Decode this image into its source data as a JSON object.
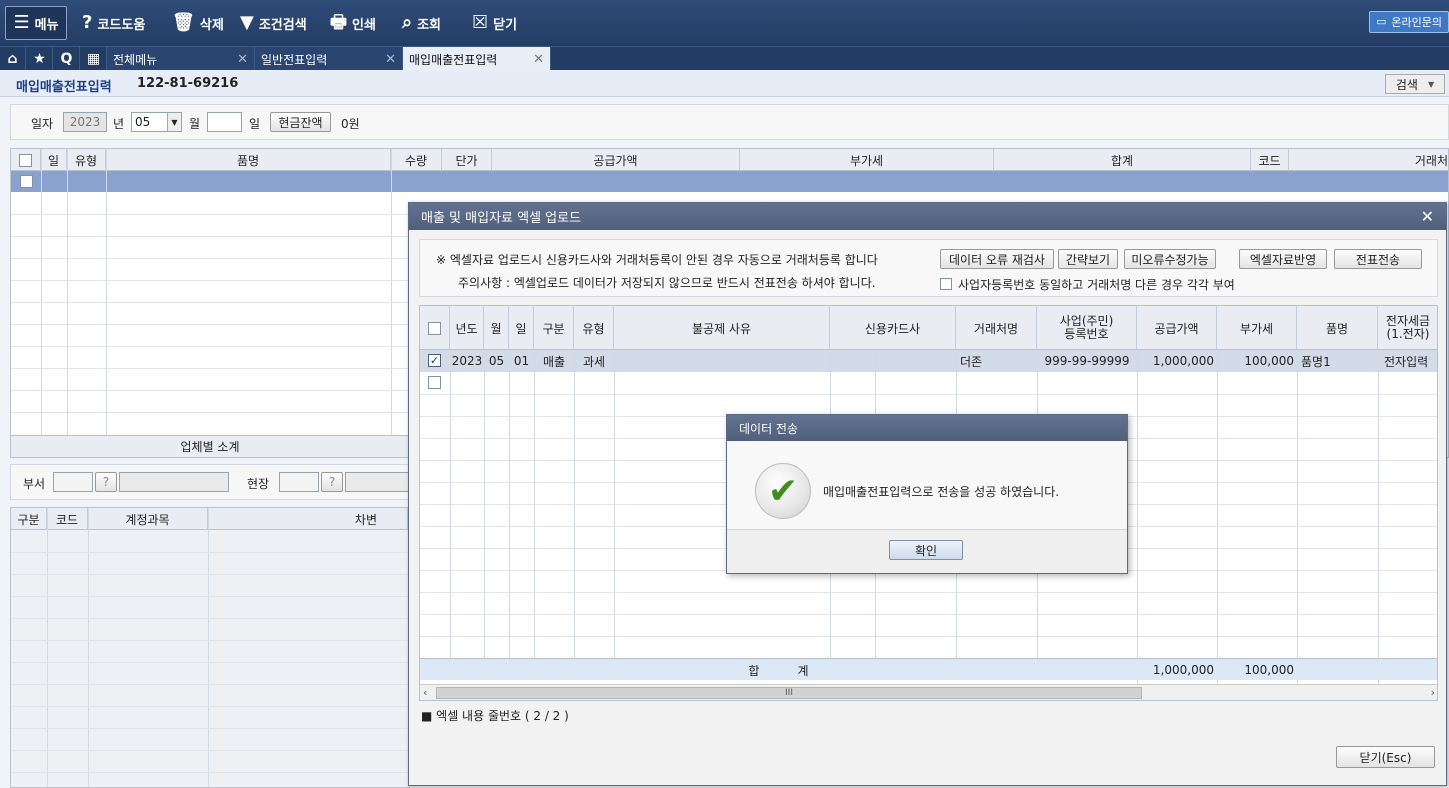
{
  "toolbar": {
    "menu": "메뉴",
    "code_help": "코드도움",
    "delete": "삭제",
    "cond_search": "조건검색",
    "print": "인쇄",
    "query": "조회",
    "close": "닫기",
    "online": "온라인문의"
  },
  "tabs": {
    "all_menu": "전체메뉴",
    "general": "일반전표입력",
    "purchase_sales": "매입매출전표입력"
  },
  "page": {
    "title": "매입매출전표입력",
    "biz_no": "122-81-69216",
    "search_label": "검색"
  },
  "filter": {
    "date_label": "일자",
    "year": "2023",
    "year_unit": "년",
    "month": "05",
    "month_unit": "월",
    "day_unit": "일",
    "cash_btn": "현금잔액",
    "cash_value": "0원"
  },
  "main_grid": {
    "headers": [
      "일",
      "유형",
      "품명",
      "수량",
      "단가",
      "공급가액",
      "부가세",
      "합계",
      "코드",
      "거래처"
    ],
    "subtotal": "업체별 소계"
  },
  "dept": {
    "dept_label": "부서",
    "site_label": "현장",
    "qmark": "?"
  },
  "journal": {
    "headers": [
      "구분",
      "코드",
      "계정과목",
      "차변"
    ]
  },
  "dialog": {
    "title": "매출 및 매입자료 엑셀 업로드",
    "notice1": "※ 엑셀자료 업로드시 신용카드사와 거래처등록이 안된 경우 자동으로 거래처등록 합니다",
    "notice2": "주의사항 : 엑셀업로드 데이터가 저장되지 않으므로 반드시 전표전송 하셔야 합니다.",
    "btn_recheck": "데이터 오류 재검사",
    "btn_simple": "간략보기",
    "btn_unfixed": "미오류수정가능",
    "btn_apply": "엑셀자료반영",
    "btn_send": "전표전송",
    "chk_label": "사업자등록번호 동일하고 거래처명 다른 경우 각각 부여",
    "headers": [
      "년도",
      "월",
      "일",
      "구분",
      "유형",
      "불공제 사유",
      "신용카드사",
      "거래처명",
      "사업(주민)\n등록번호",
      "공급가액",
      "부가세",
      "품명",
      "전자세금\n(1.전자)"
    ],
    "row": {
      "year": "2023",
      "month": "05",
      "day": "01",
      "kind": "매출",
      "type": "과세",
      "reason": "",
      "card": "",
      "customer": "더존",
      "regno": "999-99-99999",
      "supply": "1,000,000",
      "vat": "100,000",
      "item": "품명1",
      "elec": "전자입력"
    },
    "total_label": "합          계",
    "total_supply": "1,000,000",
    "total_vat": "100,000",
    "scroll_mark": "III",
    "footer_note": "■ 엑셀 내용 줄번호 ( 2 / 2 )",
    "close_btn": "닫기(Esc)"
  },
  "message": {
    "title": "데이터 전송",
    "text": "매입매출전표입력으로 전송을 성공 하였습니다.",
    "ok": "확인"
  }
}
